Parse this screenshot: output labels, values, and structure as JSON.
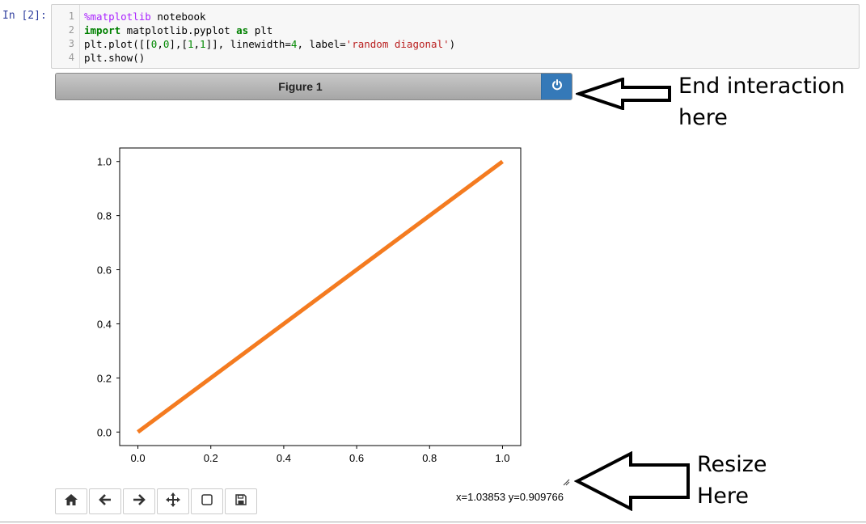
{
  "prompt": "In [2]:",
  "code_lines": [
    {
      "num": "1",
      "magic": "%matplotlib",
      "rest": " notebook"
    },
    {
      "num": "2"
    },
    {
      "num": "3"
    },
    {
      "num": "4",
      "text": "plt.show()"
    }
  ],
  "line2": {
    "kw1": "import",
    "mod": " matplotlib.pyplot ",
    "kw2": "as",
    "alias": " plt"
  },
  "line3": {
    "a": "plt.plot([[",
    "n1": "0",
    "c1": ",",
    "n2": "0",
    "b": "],[",
    "n3": "1",
    "c2": ",",
    "n4": "1",
    "c": "]], linewidth=",
    "lw": "4",
    "d": ", label=",
    "label": "'random diagonal'",
    "e": ")"
  },
  "figure": {
    "title": "Figure 1",
    "power_icon": "power-icon"
  },
  "annotations": {
    "end_line1": "End interaction",
    "end_line2": "here",
    "resize_line1": "Resize",
    "resize_line2": "Here"
  },
  "toolbar": {
    "icons": [
      "home-icon",
      "back-arrow-icon",
      "forward-arrow-icon",
      "pan-move-icon",
      "zoom-rectangle-icon",
      "save-floppy-icon"
    ]
  },
  "coordinates_readout": "x=1.03853 y=0.909766",
  "chart_data": {
    "type": "line",
    "series": [
      {
        "x": [
          0,
          1
        ],
        "y": [
          0,
          1
        ],
        "color": "#f47b20"
      }
    ],
    "xlim": [
      -0.05,
      1.05
    ],
    "ylim": [
      -0.05,
      1.05
    ],
    "xticks": [
      "0.0",
      "0.2",
      "0.4",
      "0.6",
      "0.8",
      "1.0"
    ],
    "yticks": [
      "0.0",
      "0.2",
      "0.4",
      "0.6",
      "0.8",
      "1.0"
    ],
    "xlabel": "",
    "ylabel": "",
    "title": "",
    "grid": false
  }
}
